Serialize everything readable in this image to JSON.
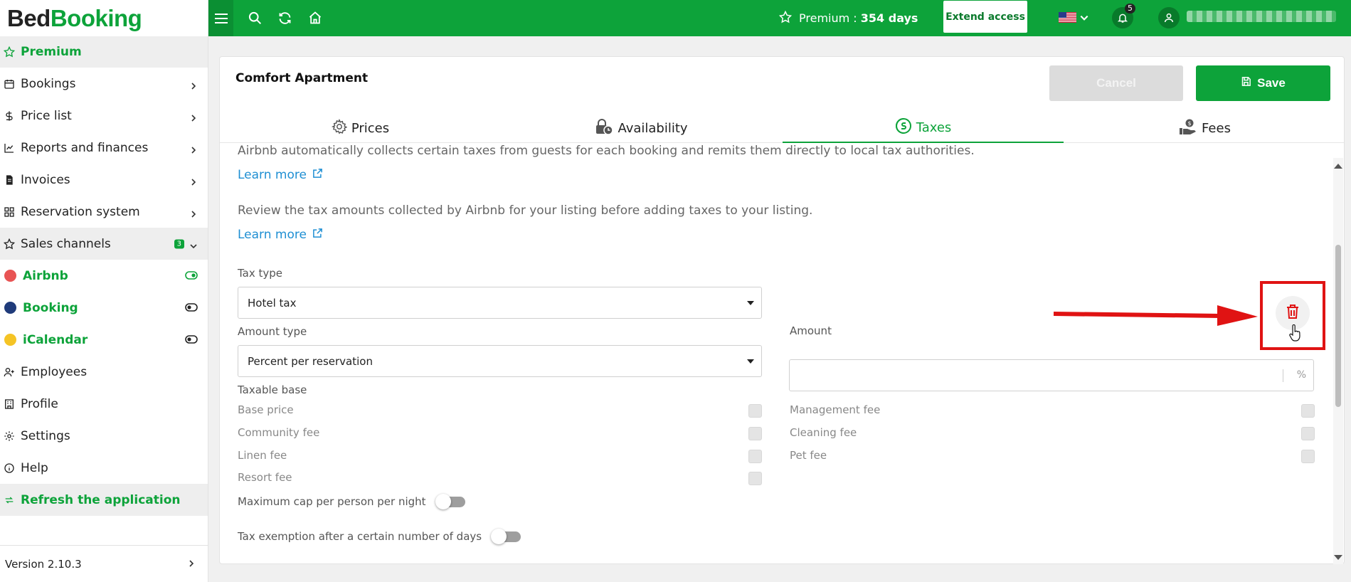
{
  "brand": {
    "part1": "Bed",
    "part2": "Booking"
  },
  "sidebar": {
    "premium": "Premium",
    "items": [
      {
        "label": "Bookings"
      },
      {
        "label": "Price list"
      },
      {
        "label": "Reports and finances"
      },
      {
        "label": "Invoices"
      },
      {
        "label": "Reservation system"
      },
      {
        "label": "Sales channels",
        "badge": "3"
      }
    ],
    "channels": [
      {
        "label": "Airbnb",
        "color": "#e85454"
      },
      {
        "label": "Booking",
        "color": "#1f3b7a"
      },
      {
        "label": "iCalendar",
        "color": "#f5c425"
      }
    ],
    "bottom_items": [
      {
        "label": "Employees"
      },
      {
        "label": "Profile"
      },
      {
        "label": "Settings"
      },
      {
        "label": "Help"
      }
    ],
    "refresh": "Refresh the application",
    "version": "Version 2.10.3"
  },
  "topbar": {
    "premium_label": "Premium : ",
    "premium_days": "354 days",
    "extend": "Extend access",
    "notifications": "5"
  },
  "card": {
    "title": "Comfort Apartment",
    "cancel": "Cancel",
    "save": "Save",
    "tabs": [
      "Prices",
      "Availability",
      "Taxes",
      "Fees"
    ],
    "active_tab": "Taxes"
  },
  "taxes": {
    "info1": "Airbnb automatically collects certain taxes from guests for each booking and remits them directly to local tax authorities.",
    "learn_more": "Learn more",
    "info2": "Review the tax amounts collected by Airbnb for your listing before adding taxes to your listing.",
    "tax_type_label": "Tax type",
    "tax_type_value": "Hotel tax",
    "amount_type_label": "Amount type",
    "amount_type_value": "Percent per reservation",
    "amount_label": "Amount",
    "amount_unit": "%",
    "taxable_base_label": "Taxable base",
    "base_left": [
      "Base price",
      "Community fee",
      "Linen fee",
      "Resort fee"
    ],
    "base_right": [
      "Management fee",
      "Cleaning fee",
      "Pet fee"
    ],
    "max_cap": "Maximum cap per person per night",
    "exemption": "Tax exemption after a certain number of days"
  },
  "colors": {
    "brand_green": "#0da33a",
    "annotation_red": "#e01313"
  }
}
